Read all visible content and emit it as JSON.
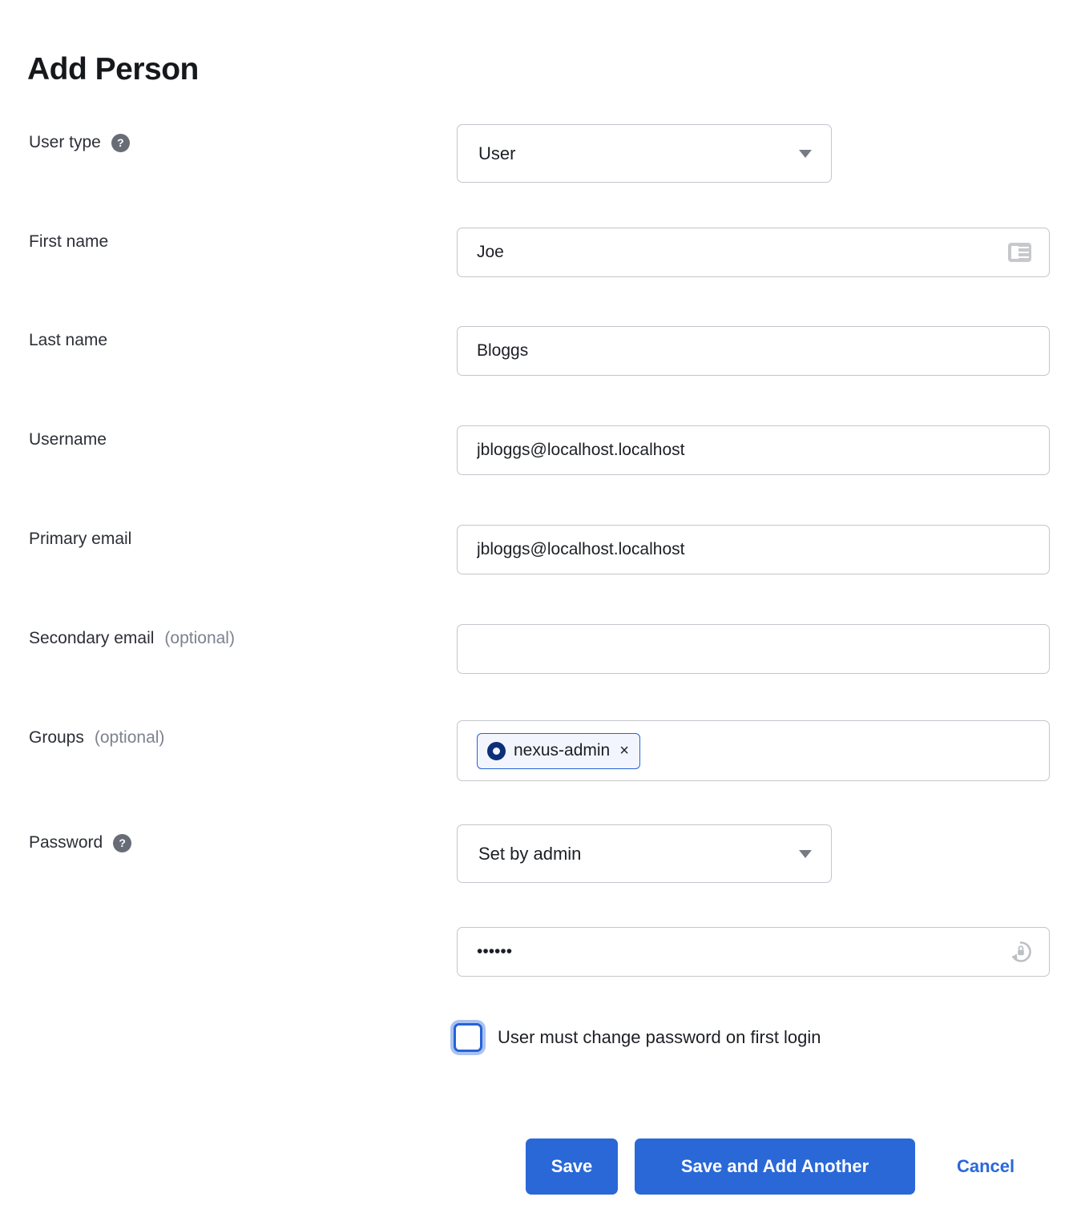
{
  "page": {
    "title": "Add Person"
  },
  "fields": {
    "user_type": {
      "label": "User type",
      "help_icon": "question-mark-icon",
      "value": "User",
      "caret_icon": "chevron-down-icon"
    },
    "first_name": {
      "label": "First name",
      "value": "Joe",
      "trailing_icon": "contact-card-icon"
    },
    "last_name": {
      "label": "Last name",
      "value": "Bloggs"
    },
    "username": {
      "label": "Username",
      "value": "jbloggs@localhost.localhost"
    },
    "primary_email": {
      "label": "Primary email",
      "value": "jbloggs@localhost.localhost"
    },
    "secondary_email": {
      "label": "Secondary email",
      "label_optional": "(optional)",
      "value": ""
    },
    "groups": {
      "label": "Groups",
      "label_optional": "(optional)",
      "chips": [
        {
          "icon": "group-ring-icon",
          "label": "nexus-admin",
          "remove_icon": "×"
        }
      ]
    },
    "password_mode": {
      "label": "Password",
      "help_icon": "question-mark-icon",
      "value": "Set by admin",
      "caret_icon": "chevron-down-icon"
    },
    "password": {
      "value": "••••••",
      "trailing_icon": "regenerate-password-icon"
    },
    "force_change": {
      "label": "User must change password on first login",
      "checked": false
    }
  },
  "actions": {
    "save_label": "Save",
    "save_add_another_label": "Save and Add Another",
    "cancel_label": "Cancel"
  },
  "colors": {
    "primary": "#2a68d8",
    "chip_border": "#2563d8",
    "chip_bg": "#f2f5fd",
    "chip_ring": "#0d2f7a",
    "border": "#c3c6cc",
    "text": "#1c1f24",
    "muted": "#7d828e"
  }
}
